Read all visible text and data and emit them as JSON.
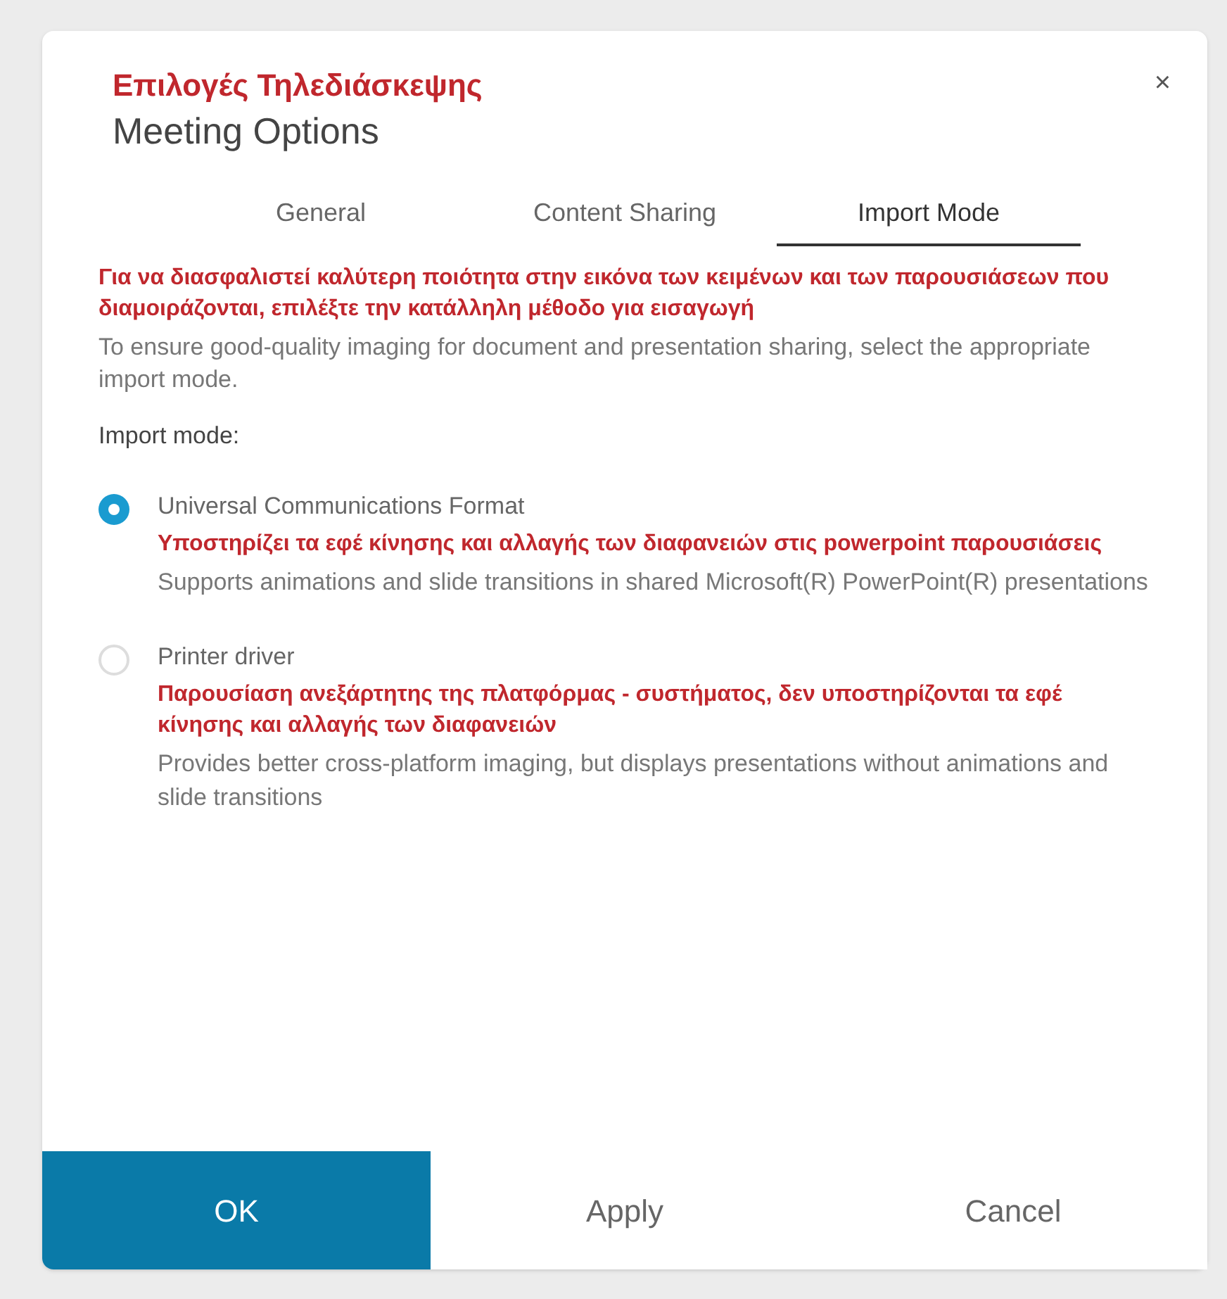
{
  "dialog": {
    "close": "×",
    "title_annotation": "Επιλογές Τηλεδιάσκεψης",
    "title": "Meeting Options"
  },
  "tabs": [
    {
      "label": "General",
      "selected": false
    },
    {
      "label": "Content Sharing",
      "selected": false
    },
    {
      "label": "Import Mode",
      "selected": true
    }
  ],
  "intro": {
    "annotation": "Για να διασφαλιστεί καλύτερη ποιότητα στην εικόνα των κειμένων και των παρουσιάσεων που διαμοιράζονται, επιλέξτε την κατάλληλη μέθοδο για εισαγωγή",
    "text": "To ensure good-quality imaging for document and presentation sharing, select the appropriate import mode."
  },
  "import_mode_label": "Import mode:",
  "options": [
    {
      "label": "Universal Communications Format",
      "selected": true,
      "annotation": "Υποστηρίζει τα εφέ κίνησης και αλλαγής των διαφανειών στις powerpoint παρουσιάσεις",
      "description": "Supports animations and slide transitions in shared Microsoft(R) PowerPoint(R) presentations"
    },
    {
      "label": "Printer driver",
      "selected": false,
      "annotation": "Παρουσίαση ανεξάρτητης της πλατφόρμας - συστήματος, δεν υποστηρίζονται τα εφέ κίνησης και αλλαγής των διαφανειών",
      "description": "Provides better cross-platform imaging, but displays presentations without animations and slide transitions"
    }
  ],
  "buttons": [
    {
      "label": "OK",
      "kind": "primary"
    },
    {
      "label": "Apply",
      "kind": "plain"
    },
    {
      "label": "Cancel",
      "kind": "plain"
    }
  ]
}
